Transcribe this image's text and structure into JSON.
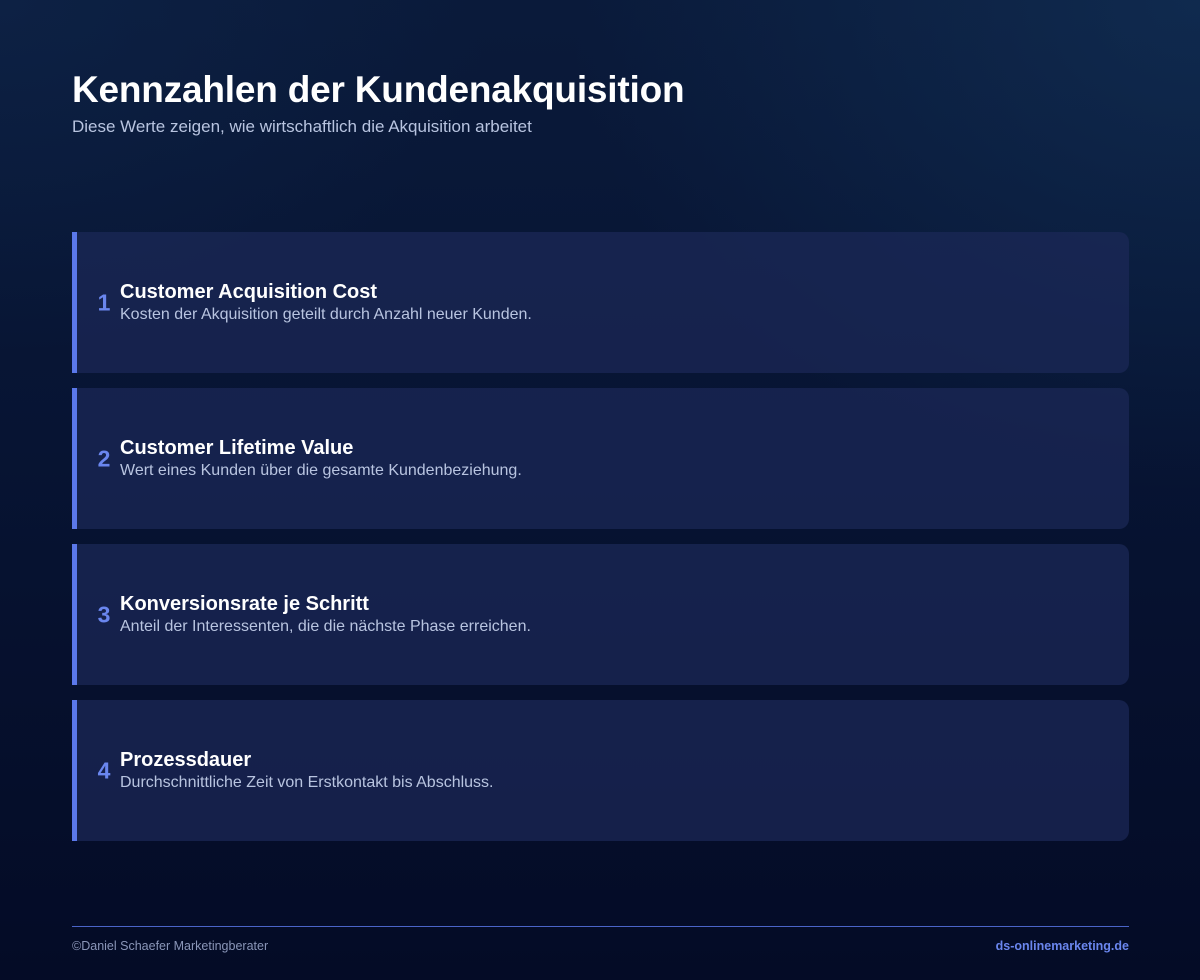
{
  "header": {
    "title": "Kennzahlen der Kundenakquisition",
    "subtitle": "Diese Werte zeigen, wie wirtschaftlich die Akquisition arbeitet"
  },
  "metrics": [
    {
      "number": "1",
      "title": "Customer Acquisition Cost",
      "description": "Kosten der Akquisition geteilt durch Anzahl neuer Kunden."
    },
    {
      "number": "2",
      "title": "Customer Lifetime Value",
      "description": "Wert eines Kunden über die gesamte Kundenbeziehung."
    },
    {
      "number": "3",
      "title": "Konversionsrate je Schritt",
      "description": "Anteil der Interessenten, die die nächste Phase erreichen."
    },
    {
      "number": "4",
      "title": "Prozessdauer",
      "description": "Durchschnittliche Zeit von Erstkontakt bis Abschluss."
    }
  ],
  "footer": {
    "copyright": "©Daniel Schaefer Marketingberater",
    "website": "ds-onlinemarketing.de"
  },
  "colors": {
    "accent": "#5b78ea",
    "number": "#6a86ee",
    "card_background": "#1c2858",
    "page_background": "#071433"
  }
}
